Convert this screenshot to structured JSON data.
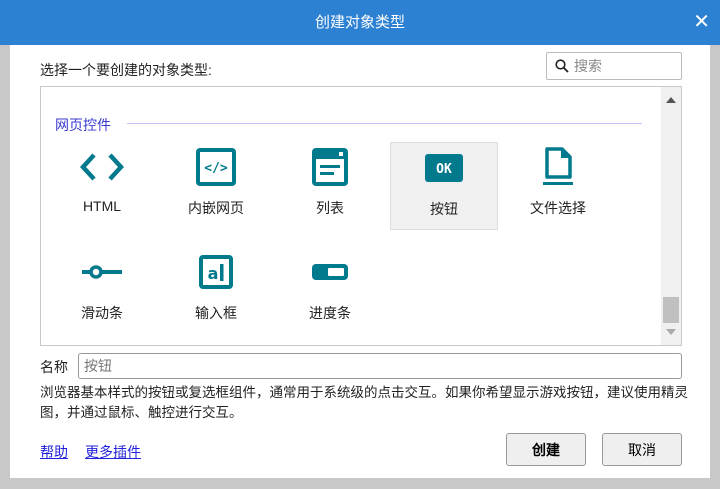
{
  "title": "创建对象类型",
  "prompt": "选择一个要创建的对象类型:",
  "search": {
    "placeholder": "搜索"
  },
  "category": "网页控件",
  "items": [
    {
      "label": "HTML",
      "icon": "html-code-icon"
    },
    {
      "label": "内嵌网页",
      "icon": "iframe-icon"
    },
    {
      "label": "列表",
      "icon": "list-icon"
    },
    {
      "label": "按钮",
      "icon": "ok-button-icon",
      "selected": true
    },
    {
      "label": "文件选择",
      "icon": "file-icon"
    },
    {
      "label": "滑动条",
      "icon": "slider-icon"
    },
    {
      "label": "输入框",
      "icon": "text-input-icon"
    },
    {
      "label": "进度条",
      "icon": "progress-bar-icon"
    }
  ],
  "name_label": "名称",
  "name_placeholder": "按钮",
  "description": "浏览器基本样式的按钮或复选框组件，通常用于系统级的点击交互。如果你希望显示游戏按钮，建议使用精灵图，并通过鼠标、触控进行交互。",
  "links": {
    "help": "帮助",
    "more_plugins": "更多插件"
  },
  "buttons": {
    "create": "创建",
    "cancel": "取消"
  },
  "accent": "#007a8c"
}
